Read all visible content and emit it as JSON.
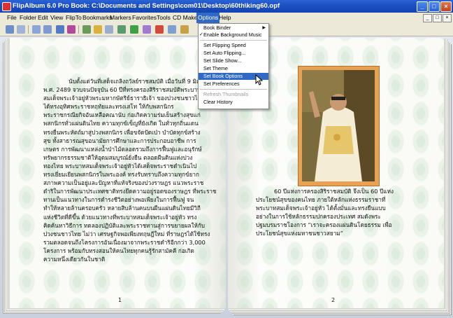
{
  "window": {
    "title": "FlipAlbum 6.0 Pro   Book: C:\\Documents and Settings\\com01\\Desktop\\60th\\king60.opf",
    "controls": [
      "_",
      "□",
      "×"
    ]
  },
  "menubar": {
    "items": [
      "File",
      "Folder",
      "Edit",
      "View",
      "FlipTo",
      "Bookmarks",
      "Markers",
      "Favorites",
      "Tools",
      "CD Maker",
      "Options",
      "Help"
    ],
    "active": "Options",
    "mdi_controls": [
      "_",
      "□",
      "×"
    ]
  },
  "options_menu": {
    "items": [
      {
        "label": "Book Binder",
        "submenu": true
      },
      {
        "label": "Enable Background Music",
        "checked": true
      },
      {
        "label": "Set Flipping Speed"
      },
      {
        "label": "Set Auto Flipping..."
      },
      {
        "label": "Set Slide Show..."
      },
      {
        "label": "Set Theme"
      },
      {
        "label": "Set Book Options",
        "highlighted": true
      },
      {
        "label": "Set Preferences"
      },
      {
        "label": "Refresh Thumbnails",
        "disabled": true
      },
      {
        "label": "Clear History"
      }
    ]
  },
  "toolbar": {
    "icons": [
      "open-book-icon",
      "view-icon",
      "first-page-icon",
      "prev-page-icon",
      "next-page-icon",
      "last-page-icon",
      "play-icon",
      "stop-icon",
      "photo-icon",
      "music-icon",
      "rotate-icon",
      "slideshow-icon",
      "print-icon",
      "cd-icon",
      "help-icon"
    ]
  },
  "left_page": {
    "text": "นับตั้งแต่วันที่เสด็จเถลิงถวัลย์ราชสมบัติ เมื่อวันที่ 9 มิถุนายน\nพ.ศ. 2489 จวบจนปัจจุบัน 60 ปีที่ทรงครองสิริราชสมบัติพระบาท\nสมเด็จพระเจ้าอยู่หัวพระมหากษัตริย์ธาราธิเจ้า ของปวงชนชาวไทย\nได้ทรงอุทิศพระราชหฤทัยและทรงเสโท ให้กับพสกนิกร\nพระราชกรณียกิจอันเหลือคณานับ ก่อเกิดความร่มเย็นสร้างสุขแก่\nพสกนิกรทั่วแผ่นดินไทย ความทุกข์เข็ญที่ยังเกิด ในทั่วทุกถิ่นแดน\nทรงยื่นพระหัตถ์มาสู่ปวงพสกนิกร เพื่อขจัดปัดเป่า บำบัดทุกข์สร้าง\nสุข ทั้งสาธารณสุขอนามัยการศึกษาและการประกอบอาชีพ การ\nเกษตร การพัฒนาแหล่งน้ำป่าไม้ตลอดรวมถึงการฟื้นฟูและอนุรักษ์\nทรัพยากรธรรมชาติให้อุดมสมบูรณ์ยั่งยืน ตลอดผืนดินแห่งปวง\nทองไทย พระบาทสมเด็จพระเจ้าอยู่หัวได้เสด็จพระราชดำเนินไป\nทรงเยี่ยมเยียนพสกนิกรในพระองค์ ทรงรับทราบถึงความทุกข์ยาก\nสภาพความเป็นอยู่และปัญหาที่แท้จริงของปวงราษฎร แนวพระราช\nดำริในการพัฒนาประเทศชาติทรงยึดความอยู่รอดของราษฎร ที่พระราช\nทานเป็นแนวทางในการดำรงชีวิตอย่างพอเพียงในการฟื้นฟู จน\nทำให้หลายล้านครอบครัว หลายสิบล้านคนบนผืนแผ่นดินไทยมีวิถี\nแห่งชีวิตที่ดีขึ้น ด้วยแนวทางที่พระบาทสมเด็จพระเจ้าอยู่หัว ทรง\nคิดค้นหาวิธีการ ทดลองปฏิบัติและพระราชทานสู่การขยายผลให้กับ\nปวงชนชาวไทย ไม่ว่า เศรษฐกิจพอเพียงทฤษฎีใหม่ ที่ราษฎรได้ใช้ทรง\nรวมตลอดจนถึงโครงการอันเนื่องมาจากพระราชดำริอีกกว่า 3,000\nโครงการ พร้อมกับทรงสอนให้คนไทยทุกคนรู้รักสามัคคี ก่อเกิด\nความหนึ่งเดียวกันในชาติ",
    "page_number": "1"
  },
  "right_page": {
    "caption": "60 ปีแห่งการครองสิริราชสมบัติ จึงเป็น 60 ปีแห่ง\nประโยชน์สุขของคนไทย ภายใต้หลักแห่งธรรมราชาที่\nพระบาทสมเด็จพระเจ้าอยู่หัว ได้ตั้งมั่นและทรงยืนแบบ\nอย่างในการใช้หลักธรรมปกครองประเทศ สมดังพระ\nปฐมบรมราชโองการ “เราจะครองแผ่นดินโดยธรรม เพื่อ\nประโยชน์สุขแห่งมหาชนชาวสยาม”",
    "page_number": "2",
    "photo": "royal-portrait-photo"
  },
  "colors": {
    "titlebar": "#1d4fc3",
    "menu_highlight": "#316ac5",
    "photo_frame": "#e7a254",
    "page_pattern": "#c4e0c8"
  }
}
